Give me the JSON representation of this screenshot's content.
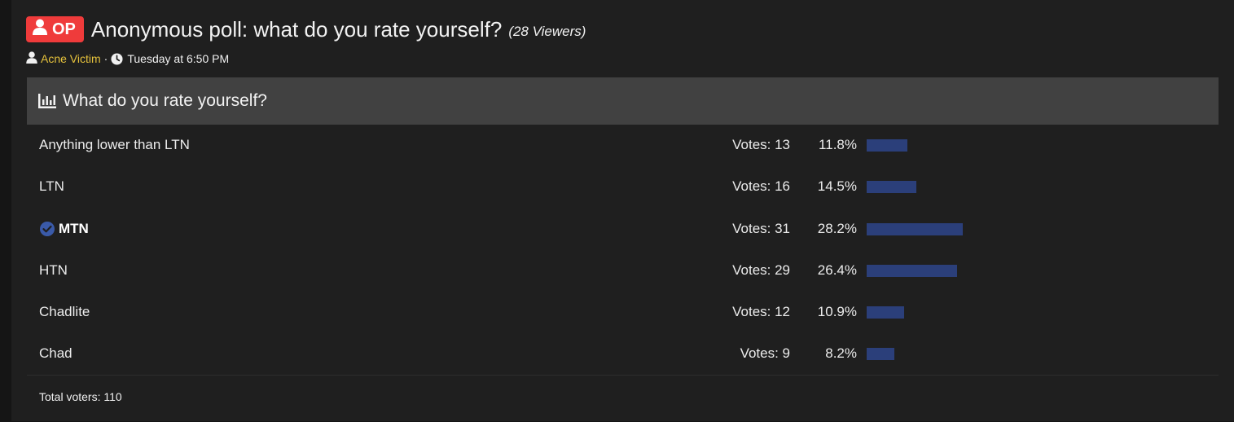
{
  "thread": {
    "badge": "OP",
    "title": "Anonymous poll: what do you rate yourself?",
    "viewers": "(28 Viewers)",
    "author": "Acne Victim",
    "separator": "·",
    "timestamp": "Tuesday at 6:50 PM"
  },
  "poll": {
    "question": "What do you rate yourself?",
    "options": [
      {
        "label": "Anything lower than LTN",
        "votes": "Votes: 13",
        "percent": "11.8%",
        "fraction": 0.118,
        "voted": false
      },
      {
        "label": "LTN",
        "votes": "Votes: 16",
        "percent": "14.5%",
        "fraction": 0.145,
        "voted": false
      },
      {
        "label": "MTN",
        "votes": "Votes: 31",
        "percent": "28.2%",
        "fraction": 0.282,
        "voted": true
      },
      {
        "label": "HTN",
        "votes": "Votes: 29",
        "percent": "26.4%",
        "fraction": 0.264,
        "voted": false
      },
      {
        "label": "Chadlite",
        "votes": "Votes: 12",
        "percent": "10.9%",
        "fraction": 0.109,
        "voted": false
      },
      {
        "label": "Chad",
        "votes": "Votes: 9",
        "percent": "8.2%",
        "fraction": 0.082,
        "voted": false
      }
    ],
    "total": "Total voters: 110"
  },
  "colors": {
    "badge": "#ef3b3b",
    "author": "#e6c23c",
    "bar": "#2b3f7a",
    "check": "#3a5aa8"
  },
  "icons": {
    "badge": "user-icon",
    "author": "user-icon",
    "time": "clock-icon",
    "poll": "bar-chart-icon",
    "voted": "check-circle-icon"
  }
}
